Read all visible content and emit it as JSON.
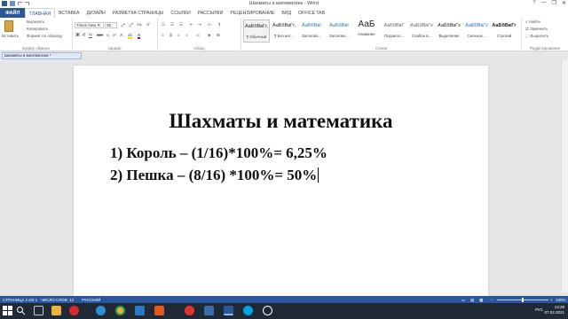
{
  "window": {
    "title": "Шахматы и математика - Word",
    "controls": [
      "?",
      "—",
      "❐",
      "✕"
    ]
  },
  "ribbon_tabs": {
    "file": "ФАЙЛ",
    "items": [
      "ГЛАВНАЯ",
      "ВСТАВКА",
      "ДИЗАЙН",
      "РАЗМЕТКА СТРАНИЦЫ",
      "ССЫЛКИ",
      "РАССЫЛКИ",
      "РЕЦЕНЗИРОВАНИЕ",
      "ВИД",
      "OFFICE TAB"
    ],
    "active_index": 0
  },
  "clipboard": {
    "paste": "Вставить",
    "cut": "Вырезать",
    "copy": "Копировать",
    "format_painter": "Формат по образцу",
    "label": "Буфер обмена"
  },
  "font": {
    "name": "Times New R",
    "size": "36",
    "label": "Шрифт"
  },
  "paragraph": {
    "label": "Абзац"
  },
  "styles": {
    "label": "Стили",
    "items": [
      {
        "sample": "АаБбВвГг,",
        "name": "¶ Обычный"
      },
      {
        "sample": "АаБбВвГг,",
        "name": "¶ Без инт..."
      },
      {
        "sample": "АаБбВвI",
        "name": "Заголово..."
      },
      {
        "sample": "АаБбВвI",
        "name": "Заголово..."
      },
      {
        "sample": "АаБ",
        "name": "Название"
      },
      {
        "sample": "АаБбВвГ",
        "name": "Подзагол..."
      },
      {
        "sample": "АаБбВвГг",
        "name": "Слабое в..."
      },
      {
        "sample": "АаБбВвГг",
        "name": "Выделение"
      },
      {
        "sample": "АаБбВвГг",
        "name": "Сильное..."
      },
      {
        "sample": "АаБбВвГг",
        "name": "Строгий"
      }
    ]
  },
  "editing": {
    "find": "Найти",
    "replace": "Заменить",
    "select": "Выделить",
    "label": "Редактирование"
  },
  "document": {
    "tab_name": "Шахматы и математика *",
    "heading": "Шахматы и математика",
    "line1": "1) Король – (1/16)*100%= 6,25%",
    "line2": "2) Пешка – (8/16) *100%= 50%"
  },
  "status": {
    "page": "СТРАНИЦА 1 ИЗ 1",
    "words": "ЧИСЛО СЛОВ: 12",
    "language": "РУССКИЙ",
    "zoom": "100%"
  },
  "taskbar": {
    "lang": "РУС",
    "time": "13:29",
    "date": "07.02.2021"
  },
  "colors": {
    "accent": "#2b579a",
    "taskbar": "#1f2a36"
  }
}
